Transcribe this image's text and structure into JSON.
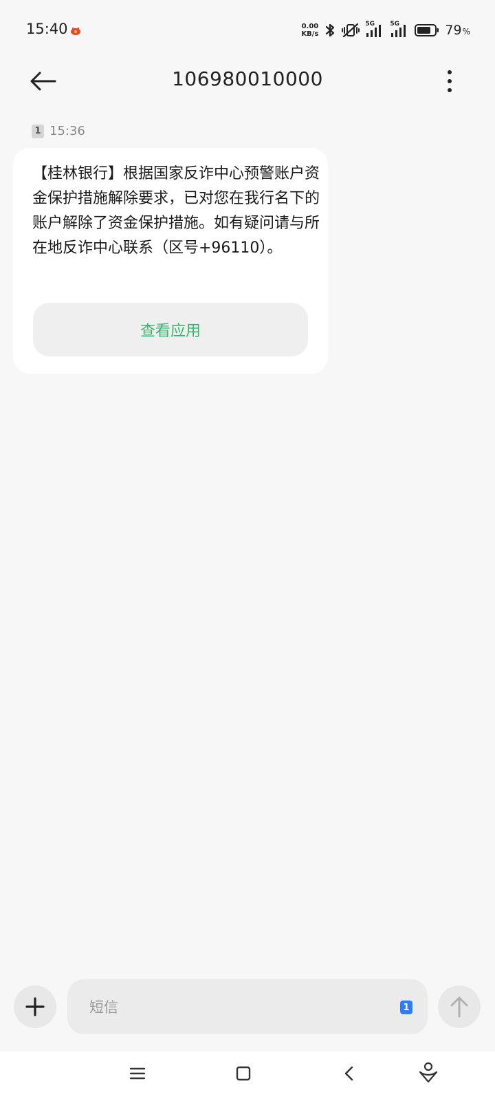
{
  "status_bar": {
    "time": "15:40",
    "net_speed_value": "0.00",
    "net_speed_unit": "KB/s",
    "sim1_network": "5G",
    "sim2_network": "5G",
    "battery_level": 79,
    "battery_percent": "79",
    "battery_unit": "%"
  },
  "top_bar": {
    "title": "106980010000"
  },
  "message": {
    "sim_slot": "1",
    "time": "15:36",
    "text": "【桂林银行】根据国家反诈中心预警账户资金保护措施解除要求，已对您在我行名下的账户解除了资金保护措施。如有疑问请与所在地反诈中心联系（区号+96110）。",
    "action_label": "查看应用"
  },
  "composer": {
    "placeholder": "短信",
    "sim_slot": "1"
  },
  "colors": {
    "background": "#f7f7f7",
    "bubble": "#ffffff",
    "action_text": "#3cb371",
    "sim_badge": "#2f7df6"
  },
  "icons": {
    "back": "arrow-left-icon",
    "more": "more-vertical-icon",
    "add": "plus-icon",
    "send": "arrow-up-icon",
    "nav_menu": "menu-icon",
    "nav_home": "square-icon",
    "nav_back": "chevron-left-icon",
    "nav_assistant": "assistant-icon"
  }
}
